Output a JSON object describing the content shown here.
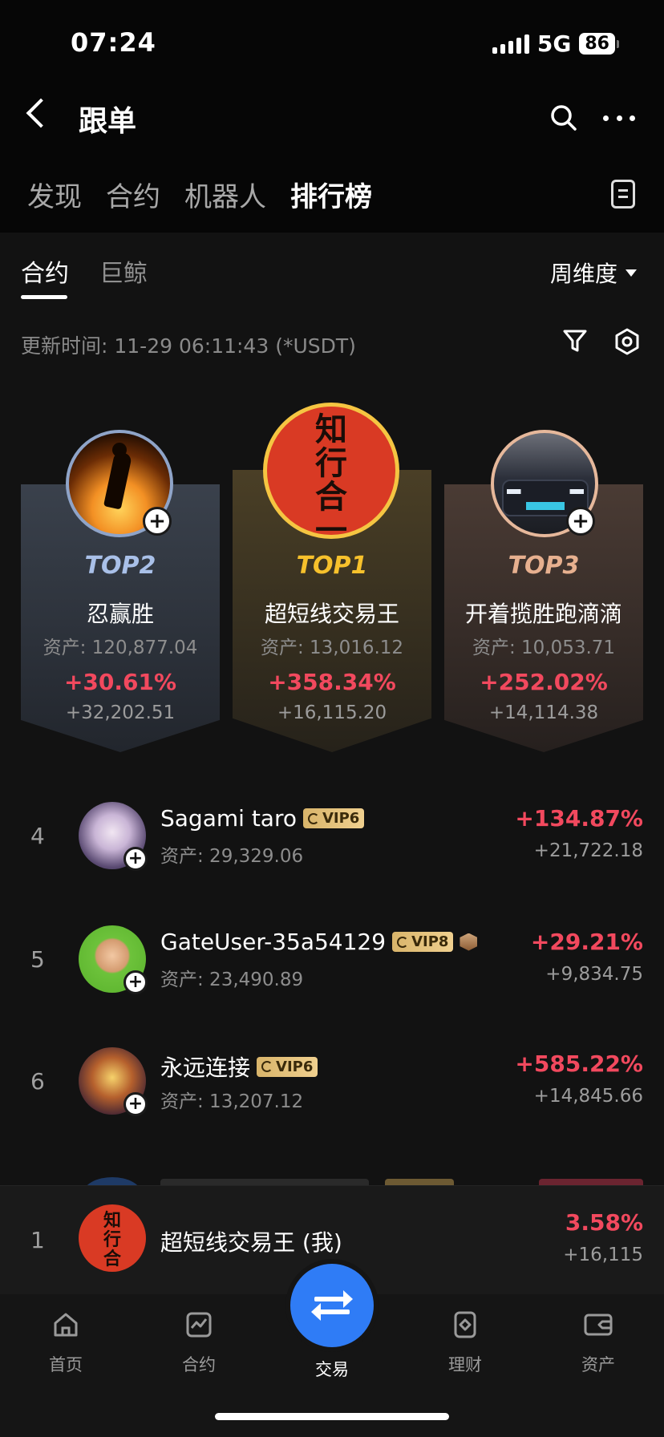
{
  "status_bar": {
    "time": "07:24",
    "network": "5G",
    "battery": "86"
  },
  "header": {
    "title": "跟单"
  },
  "top_tabs": [
    {
      "label": "发现"
    },
    {
      "label": "合约"
    },
    {
      "label": "机器人"
    },
    {
      "label": "排行榜",
      "active": true
    }
  ],
  "sub_tabs": [
    {
      "label": "合约",
      "active": true
    },
    {
      "label": "巨鲸"
    }
  ],
  "period": "周维度",
  "update_time": "更新时间: 11-29 06:11:43 (*USDT)",
  "podium": [
    {
      "rank": "TOP2",
      "name": "忍赢胜",
      "asset": "资产: 120,877.04",
      "pct": "+30.61%",
      "pnl": "+32,202.51"
    },
    {
      "rank": "TOP1",
      "name": "超短线交易王",
      "asset": "资产: 13,016.12",
      "pct": "+358.34%",
      "pnl": "+16,115.20",
      "avatar_text": "知行合一"
    },
    {
      "rank": "TOP3",
      "name": "开着揽胜跑滴滴",
      "asset": "资产: 10,053.71",
      "pct": "+252.02%",
      "pnl": "+14,114.38"
    }
  ],
  "list": [
    {
      "rank": "4",
      "name": "Sagami taro",
      "vip": "VIP6",
      "asset": "资产: 29,329.06",
      "pct": "+134.87%",
      "pnl": "+21,722.18"
    },
    {
      "rank": "5",
      "name": "GateUser-35a54129",
      "vip": "VIP8",
      "asset": "资产: 23,490.89",
      "pct": "+29.21%",
      "pnl": "+9,834.75"
    },
    {
      "rank": "6",
      "name": "永远连接",
      "vip": "VIP6",
      "asset": "资产: 13,207.12",
      "pct": "+585.22%",
      "pnl": "+14,845.66"
    }
  ],
  "mine": {
    "rank": "1",
    "name": "超短线交易王 (我)",
    "pct": "3.58%",
    "pnl": "+16,115",
    "avatar_text": "知行合一"
  },
  "bottom_nav": [
    {
      "label": "首页"
    },
    {
      "label": "合约"
    },
    {
      "label": "交易"
    },
    {
      "label": "理财"
    },
    {
      "label": "资产"
    }
  ],
  "colors": {
    "positive": "#f2495e",
    "accent": "#2f7cf6",
    "gold": "#f7c12c"
  }
}
